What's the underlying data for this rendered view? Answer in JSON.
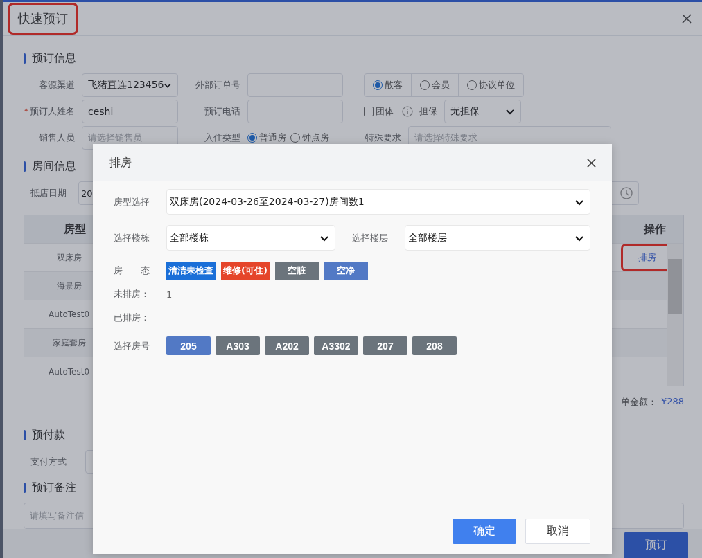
{
  "booking_dialog": {
    "title": "快速预订",
    "title_highlighted": true
  },
  "booking_info": {
    "heading": "预订信息",
    "channel": {
      "label": "客源渠道",
      "value": "飞猪直连123456"
    },
    "external_order": {
      "label": "外部订单号"
    },
    "guest_types": [
      {
        "label": "散客",
        "selected": true
      },
      {
        "label": "会员",
        "selected": false
      },
      {
        "label": "协议单位",
        "selected": false
      }
    ],
    "booker_name": {
      "label": "预订人姓名",
      "required_mark": "*",
      "value": "ceshi"
    },
    "booker_phone": {
      "label": "预订电话"
    },
    "group": {
      "label": "团体",
      "checked": false
    },
    "guarantee": {
      "label": "担保",
      "value": "无担保"
    },
    "salesperson": {
      "label": "销售人员",
      "placeholder": "请选择销售员"
    },
    "stay_type": {
      "label": "入住类型",
      "options": [
        {
          "label": "普通房",
          "selected": true
        },
        {
          "label": "钟点房",
          "selected": false
        }
      ]
    },
    "special_request": {
      "label": "特殊要求",
      "placeholder": "请选择特殊要求"
    }
  },
  "room_info": {
    "heading": "房间信息",
    "arrival": {
      "label": "抵店日期",
      "value": "20"
    },
    "table": {
      "columns": [
        "房型",
        "操作"
      ],
      "rows": [
        {
          "room_type": "双床房",
          "action": "排房",
          "highlighted": true
        },
        {
          "room_type": "海景房"
        },
        {
          "room_type": "AutoTest0"
        },
        {
          "room_type": "家庭套房"
        },
        {
          "room_type": "AutoTest0"
        }
      ]
    },
    "total": {
      "label": "单金额：",
      "value": "¥288"
    }
  },
  "prepayment": {
    "heading": "预付款",
    "payment_label": "支付方式"
  },
  "remarks": {
    "heading": "预订备注",
    "placeholder": "请填写备注信"
  },
  "submit": "预订",
  "arrange_dialog": {
    "title": "排房",
    "room_type": {
      "label": "房型选择",
      "value": "双床房(2024-03-26至2024-03-27)房间数1"
    },
    "building": {
      "label": "选择楼栋",
      "value": "全部楼栋"
    },
    "floor": {
      "label": "选择楼层",
      "value": "全部楼层"
    },
    "status": {
      "label": "房　　态",
      "tags": [
        {
          "label": "清洁未检查",
          "color": "#1a6fd8"
        },
        {
          "label": "维修(可住)",
          "color": "#e5452a"
        },
        {
          "label": "空脏",
          "color": "#6b747c"
        },
        {
          "label": "空净",
          "color": "#5279c5"
        }
      ]
    },
    "unassigned": {
      "label": "未排房：",
      "value": "1"
    },
    "assigned": {
      "label": "已排房："
    },
    "rooms": {
      "label": "选择房号",
      "items": [
        {
          "label": "205",
          "selected": true
        },
        {
          "label": "A303",
          "selected": false
        },
        {
          "label": "A202",
          "selected": false
        },
        {
          "label": "A3302",
          "selected": false
        },
        {
          "label": "207",
          "selected": false
        },
        {
          "label": "208",
          "selected": false
        }
      ]
    },
    "confirm": "确定",
    "cancel": "取消"
  }
}
